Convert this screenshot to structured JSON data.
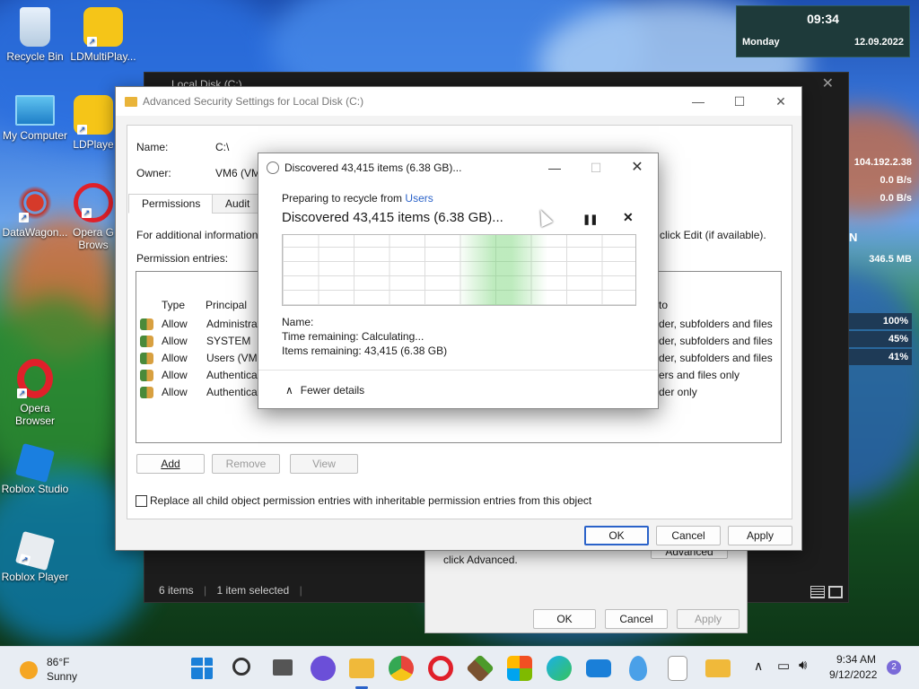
{
  "desktop": {
    "icons": [
      {
        "label": "Recycle Bin",
        "icon": "recycle-bin-icon"
      },
      {
        "label": "LDMultiPlay...",
        "icon": "ldmultiplayer-icon"
      },
      {
        "label": "My Computer",
        "icon": "computer-icon"
      },
      {
        "label": "LDPlaye",
        "icon": "ldplayer-icon"
      },
      {
        "label": "DataWagon...",
        "icon": "datawagon-icon"
      },
      {
        "label": "Opera G",
        "label2": "Brows",
        "icon": "opera-gx-icon"
      },
      {
        "label": "Opera",
        "label2": "Browser",
        "icon": "opera-icon"
      },
      {
        "label": "Roblox Studio",
        "icon": "roblox-studio-icon"
      },
      {
        "label": "Roblox Player",
        "icon": "roblox-player-icon"
      }
    ]
  },
  "widget": {
    "time": "09:34",
    "day": "Monday",
    "date": "12.09.2022",
    "ip": "104.192.2.38",
    "up": "0.0 B/s",
    "down": "0.0 B/s",
    "n": "N",
    "mem": "346.5 MB",
    "p1": "100%",
    "p2": "45%",
    "p3": "41%"
  },
  "back_window": {
    "title": "Local Disk (C:)",
    "status_items": "6 items",
    "status_selected": "1 item selected"
  },
  "properties_dialog": {
    "hint": "click Advanced.",
    "advanced_label": "Advanced",
    "ok": "OK",
    "cancel": "Cancel",
    "apply": "Apply"
  },
  "advanced": {
    "title": "Advanced Security Settings for Local Disk (C:)",
    "name_label": "Name:",
    "name_value": "C:\\",
    "owner_label": "Owner:",
    "owner_value": "VM6 (VM",
    "tabs": [
      "Permissions",
      "Audit"
    ],
    "info": "For additional information",
    "info_right": "click Edit (if available).",
    "entries_label": "Permission entries:",
    "col_type": "Type",
    "col_principal": "Principal",
    "col_applies": "to",
    "rows": [
      {
        "type": "Allow",
        "principal": "Administrat",
        "applies": "der, subfolders and files"
      },
      {
        "type": "Allow",
        "principal": "SYSTEM",
        "applies": "der, subfolders and files"
      },
      {
        "type": "Allow",
        "principal": "Users (VM6",
        "applies": "der, subfolders and files"
      },
      {
        "type": "Allow",
        "principal": "Authenticat",
        "applies": "ers and files only"
      },
      {
        "type": "Allow",
        "principal": "Authenticat",
        "applies": "der only"
      }
    ],
    "add": "Add",
    "remove": "Remove",
    "view": "View",
    "replace": "Replace all child object permission entries with inheritable permission entries from this object",
    "ok": "OK",
    "cancel": "Cancel",
    "apply": "Apply"
  },
  "progress": {
    "title": "Discovered 43,415 items (6.38 GB)...",
    "preparing": "Preparing to recycle from",
    "source": "Users",
    "heading": "Discovered 43,415 items (6.38 GB)...",
    "name_label": "Name:",
    "time_remaining": "Time remaining:  Calculating...",
    "items_remaining": "Items remaining:  43,415 (6.38 GB)",
    "fewer_details": "Fewer details"
  },
  "taskbar": {
    "weather_temp": "86°F",
    "weather_desc": "Sunny",
    "time": "9:34 AM",
    "date": "9/12/2022",
    "notifications": "2"
  }
}
